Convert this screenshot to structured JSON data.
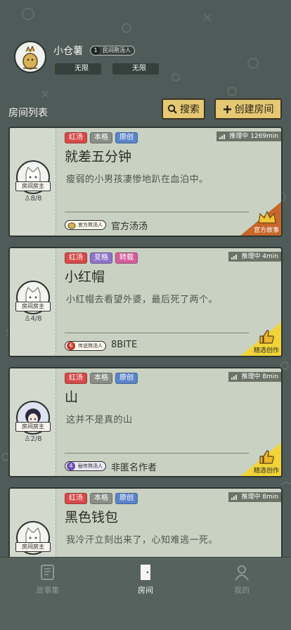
{
  "profile": {
    "username": "小仓薯",
    "level": "1",
    "level_title": "民间熬汤人",
    "coins": "无限",
    "energy": "无限"
  },
  "room_list_title": "房间列表",
  "search_label": "搜索",
  "create_label": "创建房间",
  "owner_tag": "房间房主",
  "rooms": [
    {
      "tags": [
        "红汤",
        "本格",
        "原创"
      ],
      "status": "推理中 1269min",
      "title": "就差五分钟",
      "desc": "瘦弱的小男孩凄惨地趴在血泊中。",
      "count": "8/8",
      "author_badge": "官方熬汤人",
      "author": "官方汤汤",
      "corner_label": "官方故事"
    },
    {
      "tags": [
        "红汤",
        "变格",
        "转载"
      ],
      "status": "推理中 4min",
      "title": "小红帽",
      "desc": "小红帽去看望外婆，最后死了两个。",
      "count": "4/8",
      "author_badge": "传说熬汤人",
      "author_level": "6",
      "author": "8BITE",
      "corner_label": "精选创作"
    },
    {
      "tags": [
        "红汤",
        "本格",
        "原创"
      ],
      "status": "推理中 8min",
      "title": "山",
      "desc": "这并不是真的山",
      "count": "2/8",
      "author_badge": "秘传熬汤人",
      "author_level": "4",
      "author": "非匿名作者",
      "corner_label": "精选创作"
    },
    {
      "tags": [
        "红汤",
        "本格",
        "原创"
      ],
      "status": "推理中 8min",
      "title": "黑色钱包",
      "desc": "我冷汗立刻出来了，心知难逃一死。",
      "count": ""
    }
  ],
  "tabs": [
    {
      "label": "故事集",
      "active": false
    },
    {
      "label": "房间",
      "active": true
    },
    {
      "label": "我的",
      "active": false
    }
  ],
  "colors": {
    "background": "#4f5b58",
    "card": "#c9d2c2",
    "button": "#e4c873",
    "tag_red": "#d64a4a",
    "tag_gray": "#8a8f88",
    "tag_blue": "#5b84c9",
    "tag_pink": "#d45f9c",
    "tag_purple": "#8e74c9",
    "corner_orange": "#c7672a",
    "corner_yellow": "#f0d43a"
  }
}
